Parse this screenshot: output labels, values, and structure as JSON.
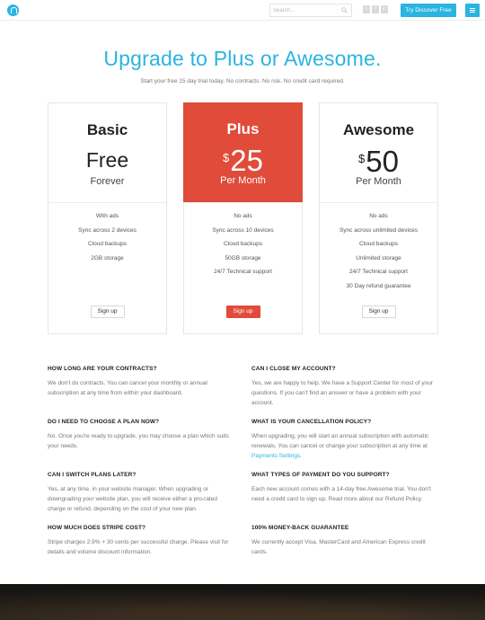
{
  "header": {
    "search_placeholder": "Search...",
    "cta_label": "Try Discover Free",
    "icons": [
      "logo-icon",
      "search-icon",
      "twitter-icon",
      "facebook-icon",
      "linkedin-icon",
      "menu-icon"
    ],
    "accent": "#2ab4e0"
  },
  "hero": {
    "title": "Upgrade to Plus or Awesome.",
    "subtitle": "Start your free 15 day trial today. No contracts. No risk. No credit card required."
  },
  "plans": [
    {
      "name": "Basic",
      "price": "Free",
      "period": "Forever",
      "features": [
        "With ads",
        "Sync across 2 devices",
        "Cloud backups",
        "2GB storage"
      ],
      "button": "Sign up"
    },
    {
      "name": "Plus",
      "currency": "$",
      "price": "25",
      "period": "Per Month",
      "features": [
        "No ads",
        "Sync across 10 devices",
        "Cloud backups",
        "50GB storage",
        "24/7 Technical support"
      ],
      "button": "Sign up",
      "highlight_color": "#e04b3a"
    },
    {
      "name": "Awesome",
      "currency": "$",
      "price": "50",
      "period": "Per Month",
      "features": [
        "No ads",
        "Sync across unlimited devices",
        "Cloud backups",
        "Unlimited storage",
        "24/7 Technical support",
        "30 Day refund guarantee"
      ],
      "button": "Sign up"
    }
  ],
  "faq": {
    "left": [
      {
        "q": "HOW LONG ARE YOUR CONTRACTS?",
        "a": "We don't do contracts. You can cancel your monthly or annual subscription at any time from within your dashboard."
      },
      {
        "q": "DO I NEED TO CHOOSE A PLAN NOW?",
        "a": "No. Once you're ready to upgrade, you may choose a plan which suits your needs."
      },
      {
        "q": "CAN I SWITCH PLANS LATER?",
        "a": "Yes, at any time, in your website manager. When upgrading or downgrading your website plan, you will receive either a pro-rated charge or refund, depending on the cost of your new plan."
      },
      {
        "q": "HOW MUCH DOES STRIPE COST?",
        "a": "Stripe charges 2.9% + 30 cents per successful charge. Please visit for details and volume discount information."
      }
    ],
    "right": [
      {
        "q": "CAN I CLOSE MY ACCOUNT?",
        "a": "Yes, we are happy to help. We have a Support Center for most of your questions. If you can't find an answer or have a problem with your account."
      },
      {
        "q": "WHAT IS YOUR CANCELLATION POLICY?",
        "a": "When upgrading, you will start an annual subscription with automatic renewals. You can cancel or change your subscription at any time at",
        "link": "Payments Settings."
      },
      {
        "q": "WHAT TYPES OF PAYMENT DO YOU SUPPORT?",
        "a": "Each new account comes with a 14-day free Awesome trial. You don't need a credit card to sign up. Read more about our Refund Policy."
      },
      {
        "q": "100% MONEY-BACK GUARANTEE",
        "a": "We currently accept Visa, MasterCard and American Express credit cards."
      }
    ]
  }
}
